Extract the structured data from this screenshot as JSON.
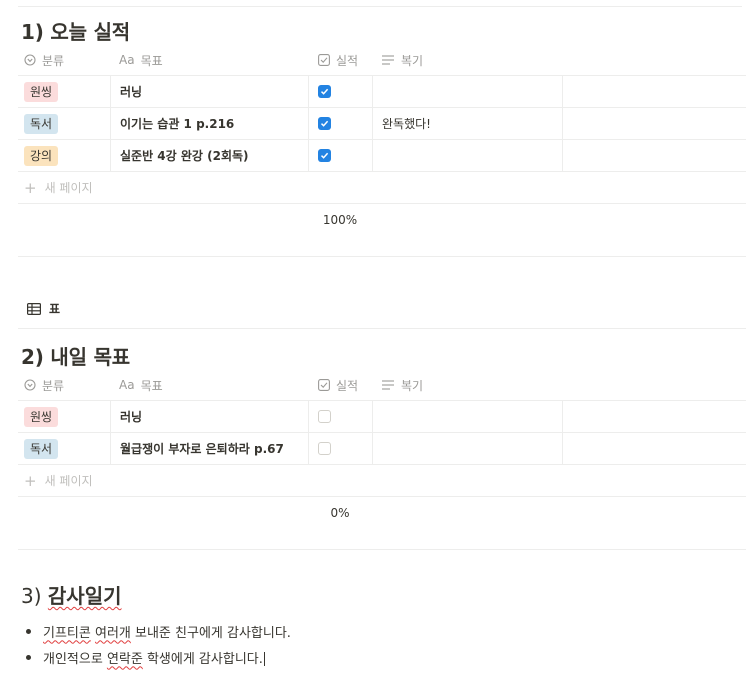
{
  "colors": {
    "text": "#37352f",
    "muted": "#9b9a97",
    "border": "#ededec",
    "check_blue": "#2383e2",
    "squiggle": "#e03e3e"
  },
  "tables": [
    {
      "title": "1) 오늘 실적",
      "headers": {
        "category": "분류",
        "goal": "목표",
        "done": "실적",
        "review": "복기"
      },
      "header_icons": {
        "category": "select-icon",
        "goal": "Aa",
        "done": "checkbox-icon",
        "review": "text-lines-icon"
      },
      "rows": [
        {
          "category": "원씽",
          "tag_bg": "#fbdcdc",
          "goal": "러닝",
          "done": true,
          "review": ""
        },
        {
          "category": "독서",
          "tag_bg": "#d3e5ef",
          "goal": "이기는 습관 1 p.216",
          "done": true,
          "review": "완독했다!"
        },
        {
          "category": "강의",
          "tag_bg": "#fbe3bd",
          "goal": "실준반 4강 완강 (2회독)",
          "done": true,
          "review": ""
        }
      ],
      "new_page": "새 페이지",
      "calc": "100%"
    },
    {
      "title": "2) 내일 목표",
      "headers": {
        "category": "분류",
        "goal": "목표",
        "done": "실적",
        "review": "복기"
      },
      "header_icons": {
        "category": "select-icon",
        "goal": "Aa",
        "done": "checkbox-icon",
        "review": "text-lines-icon"
      },
      "rows": [
        {
          "category": "원씽",
          "tag_bg": "#fbdcdc",
          "goal": "러닝",
          "done": false,
          "review": ""
        },
        {
          "category": "독서",
          "tag_bg": "#d3e5ef",
          "goal": "월급쟁이 부자로 은퇴하라 p.67",
          "done": false,
          "review": ""
        }
      ],
      "new_page": "새 페이지",
      "calc": "0%"
    }
  ],
  "view_label": "표",
  "section3": {
    "prefix": "3) ",
    "title": "감사일기",
    "bullets": [
      {
        "pre": "",
        "sq": "기프티콘",
        "mid": " ",
        "sq2": "여러개",
        "post": " 보내준 친구에게 감사합니다."
      },
      {
        "pre": "개인적으로 ",
        "sq": "연락준",
        "mid": "",
        "sq2": "",
        "post": " 학생에게 감사합니다."
      }
    ]
  }
}
